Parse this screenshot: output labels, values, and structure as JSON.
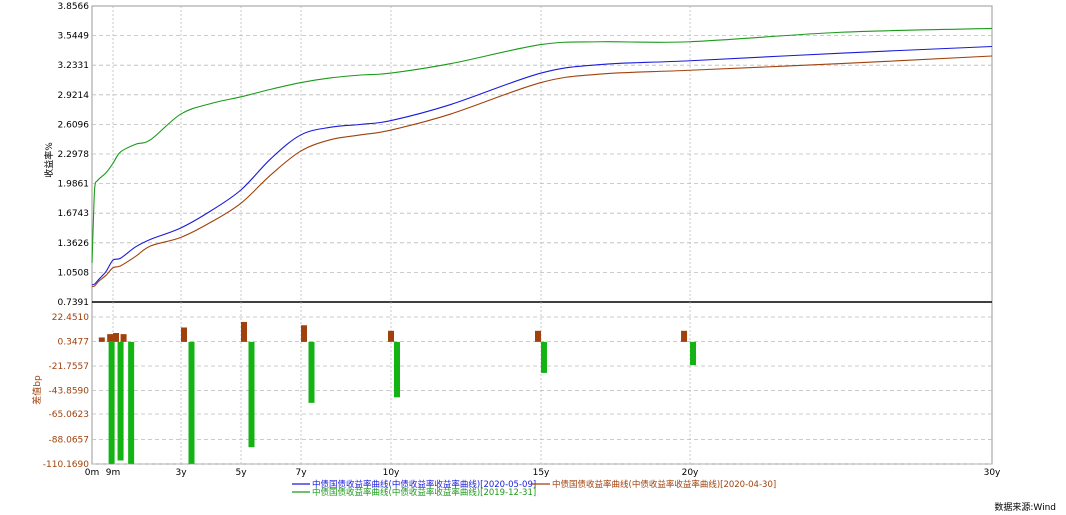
{
  "source_label": "数据来源:Wind",
  "chart_data": {
    "type": "line",
    "x": {
      "ticks": [
        {
          "label": "0m",
          "years": 0
        },
        {
          "label": "9m",
          "years": 0.75
        },
        {
          "label": "3y",
          "years": 3
        },
        {
          "label": "5y",
          "years": 5
        },
        {
          "label": "7y",
          "years": 7
        },
        {
          "label": "10y",
          "years": 10
        },
        {
          "label": "15y",
          "years": 15
        },
        {
          "label": "20y",
          "years": 20
        },
        {
          "label": "30y",
          "years": 30
        }
      ],
      "range": [
        0,
        30
      ],
      "gridlines_at_years": [
        0.75,
        3,
        5,
        7,
        10,
        15,
        20
      ]
    },
    "upper_panel": {
      "ylabel": "收益率%",
      "ylim": [
        0.7391,
        3.8566
      ],
      "yticks": [
        "3.8566",
        "3.5449",
        "3.2331",
        "2.9214",
        "2.6096",
        "2.2978",
        "1.9861",
        "1.6743",
        "1.3626",
        "1.0508",
        "0.7391"
      ],
      "series": [
        {
          "name": "中债国债收益率曲线(中债收益率收益率曲线)[2020-05-09]",
          "color": "#1a1adb",
          "points": [
            [
              0,
              0.92
            ],
            [
              0.1,
              0.93
            ],
            [
              0.25,
              0.98
            ],
            [
              0.5,
              1.06
            ],
            [
              0.75,
              1.18
            ],
            [
              1,
              1.2
            ],
            [
              1.5,
              1.32
            ],
            [
              2,
              1.4
            ],
            [
              3,
              1.52
            ],
            [
              4,
              1.7
            ],
            [
              5,
              1.92
            ],
            [
              6,
              2.25
            ],
            [
              7,
              2.5
            ],
            [
              8,
              2.58
            ],
            [
              9,
              2.61
            ],
            [
              10,
              2.65
            ],
            [
              12,
              2.82
            ],
            [
              15,
              3.15
            ],
            [
              17,
              3.24
            ],
            [
              20,
              3.28
            ],
            [
              25,
              3.36
            ],
            [
              30,
              3.43
            ]
          ]
        },
        {
          "name": "中债国债收益率曲线(中债收益率收益率曲线)[2020-04-30]",
          "color": "#a0410d",
          "points": [
            [
              0,
              0.9
            ],
            [
              0.1,
              0.91
            ],
            [
              0.25,
              0.96
            ],
            [
              0.5,
              1.02
            ],
            [
              0.75,
              1.1
            ],
            [
              1,
              1.12
            ],
            [
              1.5,
              1.22
            ],
            [
              2,
              1.33
            ],
            [
              3,
              1.42
            ],
            [
              4,
              1.58
            ],
            [
              5,
              1.78
            ],
            [
              6,
              2.08
            ],
            [
              7,
              2.33
            ],
            [
              8,
              2.45
            ],
            [
              9,
              2.5
            ],
            [
              10,
              2.55
            ],
            [
              12,
              2.72
            ],
            [
              15,
              3.05
            ],
            [
              17,
              3.14
            ],
            [
              20,
              3.18
            ],
            [
              25,
              3.25
            ],
            [
              30,
              3.33
            ]
          ]
        },
        {
          "name": "中债国债收益率曲线(中债收益率收益率曲线)[2019-12-31]",
          "color": "#1a9a1a",
          "points": [
            [
              0,
              1.15
            ],
            [
              0.05,
              1.6
            ],
            [
              0.1,
              1.95
            ],
            [
              0.2,
              2.02
            ],
            [
              0.5,
              2.1
            ],
            [
              0.75,
              2.2
            ],
            [
              1,
              2.32
            ],
            [
              1.5,
              2.4
            ],
            [
              2,
              2.45
            ],
            [
              3,
              2.72
            ],
            [
              4,
              2.83
            ],
            [
              5,
              2.9
            ],
            [
              6,
              2.98
            ],
            [
              7,
              3.05
            ],
            [
              8,
              3.1
            ],
            [
              9,
              3.13
            ],
            [
              10,
              3.15
            ],
            [
              12,
              3.25
            ],
            [
              15,
              3.45
            ],
            [
              17,
              3.48
            ],
            [
              20,
              3.48
            ],
            [
              25,
              3.58
            ],
            [
              30,
              3.62
            ]
          ]
        }
      ]
    },
    "lower_panel": {
      "ylabel": "差值bp",
      "ylim": [
        -110.169,
        22.451
      ],
      "yticks": [
        "22.4510",
        "0.3477",
        "-21.7557",
        "-43.8590",
        "-65.0623",
        "-88.0657",
        "-110.1690"
      ],
      "bars_brown": [
        [
          0.35,
          4
        ],
        [
          0.65,
          7
        ],
        [
          0.85,
          8
        ],
        [
          1.1,
          7
        ],
        [
          3.1,
          13
        ],
        [
          5.1,
          18
        ],
        [
          7.1,
          15
        ],
        [
          10.0,
          10
        ],
        [
          14.9,
          10
        ],
        [
          19.8,
          10
        ]
      ],
      "bars_green": [
        [
          0.7,
          -110
        ],
        [
          1.0,
          -107
        ],
        [
          1.35,
          -110
        ],
        [
          3.35,
          -110
        ],
        [
          5.35,
          -95
        ],
        [
          7.35,
          -55
        ],
        [
          10.2,
          -50
        ],
        [
          15.1,
          -28
        ],
        [
          20.1,
          -21
        ]
      ]
    }
  }
}
